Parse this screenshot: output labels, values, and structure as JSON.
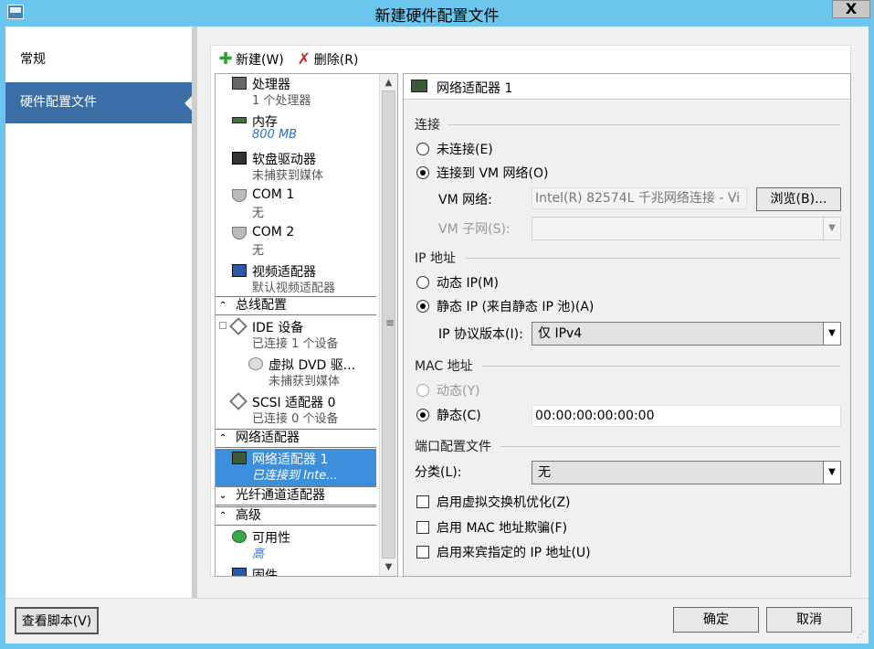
{
  "window": {
    "title": "新建硬件配置文件",
    "close_label": "X"
  },
  "nav": {
    "items": [
      {
        "label": "常规"
      },
      {
        "label": "硬件配置文件"
      }
    ]
  },
  "toolbar": {
    "new_label": "新建(W)",
    "delete_label": "删除(R)"
  },
  "tree": {
    "processor": {
      "name": "处理器",
      "sub": "1 个处理器"
    },
    "memory": {
      "name": "内存",
      "sub": "800 MB"
    },
    "floppy": {
      "name": "软盘驱动器",
      "sub": "未捕获到媒体"
    },
    "com1": {
      "name": "COM 1",
      "sub": "无"
    },
    "com2": {
      "name": "COM 2",
      "sub": "无"
    },
    "video": {
      "name": "视频适配器",
      "sub": "默认视频适配器"
    },
    "cat_bus": "总线配置",
    "ide": {
      "name": "IDE 设备",
      "sub": "已连接 1 个设备"
    },
    "dvd": {
      "name": "虚拟 DVD 驱...",
      "sub": "未捕获到媒体"
    },
    "scsi": {
      "name": "SCSI 适配器 0",
      "sub": "已连接 0 个设备"
    },
    "cat_net": "网络适配器",
    "nic": {
      "name": "网络适配器 1",
      "sub": "已连接到 Inte..."
    },
    "cat_fc": "光纤通道适配器",
    "cat_adv": "高级",
    "availability": {
      "name": "可用性",
      "sub": "高"
    },
    "firmware": {
      "name": "固件"
    }
  },
  "details": {
    "title": "网络适配器 1",
    "conn_group": "连接",
    "not_connected": "未连接(E)",
    "connect_vm": "连接到 VM 网络(O)",
    "vm_network_label": "VM 网络:",
    "vm_network_value": "Intel(R) 82574L 千兆网络连接 - Vi",
    "browse_label": "浏览(B)...",
    "vm_subnet_label": "VM 子网(S):",
    "vm_subnet_value": "",
    "ip_group": "IP 地址",
    "dynamic_ip": "动态 IP(M)",
    "static_ip": "静态 IP (来自静态 IP 池)(A)",
    "ip_version_label": "IP 协议版本(I):",
    "ip_version_value": "仅 IPv4",
    "mac_group": "MAC 地址",
    "mac_dynamic": "动态(Y)",
    "mac_static": "静态(C)",
    "mac_value": "00:00:00:00:00:00",
    "port_group": "端口配置文件",
    "class_label": "分类(L):",
    "class_value": "无",
    "opt_vswitch": "启用虚拟交换机优化(Z)",
    "opt_mac_spoof": "启用 MAC 地址欺骗(F)",
    "opt_guest_ip": "启用来宾指定的 IP 地址(U)"
  },
  "footer": {
    "view_script": "查看脚本(V)",
    "ok": "确定",
    "cancel": "取消"
  }
}
